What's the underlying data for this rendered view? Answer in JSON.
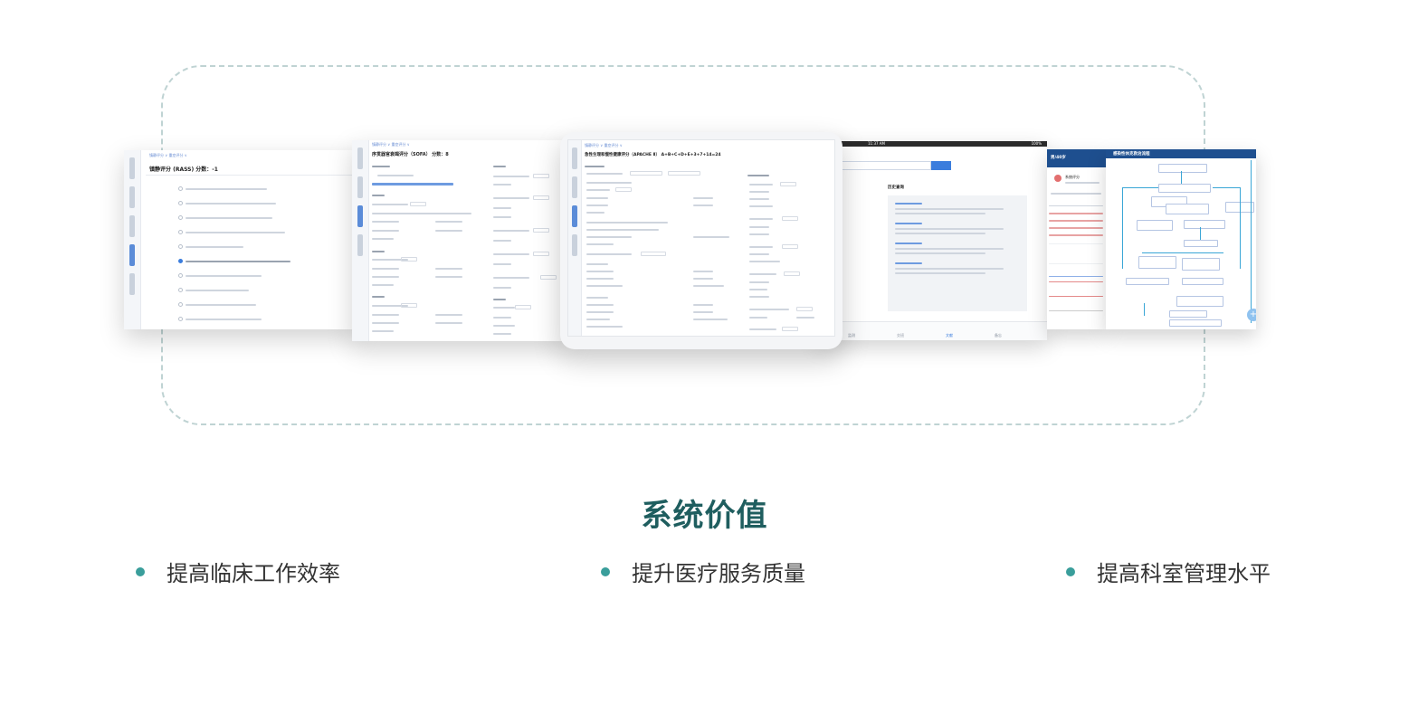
{
  "heading": "系统价值",
  "values": [
    {
      "label": "提高临床工作效率"
    },
    {
      "label": "提升医疗服务质量"
    },
    {
      "label": "提高科室管理水平"
    }
  ],
  "screens": {
    "rass": {
      "breadcrumb": "镇静评分 ∨  重症评分 ∨",
      "title": "镇静评分 (RASS)    分数：-1"
    },
    "sofa": {
      "breadcrumb": "镇静评分 ∨  重症评分 ∨",
      "title": "序贯器官衰竭评分（SOFA）  分数：8"
    },
    "apache": {
      "breadcrumb": "镇静评分 ∨  重症评分 ∨",
      "title": "急性生理和慢性健康评分（APACHE Ⅱ）      A+B+C+D+E+3+7+14=24"
    },
    "ipad": {
      "time": "11:37 AM",
      "battery": "100%",
      "section": "历史查询",
      "tabs": [
        "监测",
        "交班",
        "文献",
        "备忘"
      ]
    },
    "phone": {
      "header": "男/40岁",
      "title": "系统评分"
    },
    "flow": {
      "title": "感染性休克救治流程"
    }
  },
  "colors": {
    "heading": "#1f5e5f",
    "bullet": "#3a9e9b",
    "frame": "#bfd3d3",
    "accent": "#3b7ddd",
    "flow_header": "#1e4f8f"
  }
}
